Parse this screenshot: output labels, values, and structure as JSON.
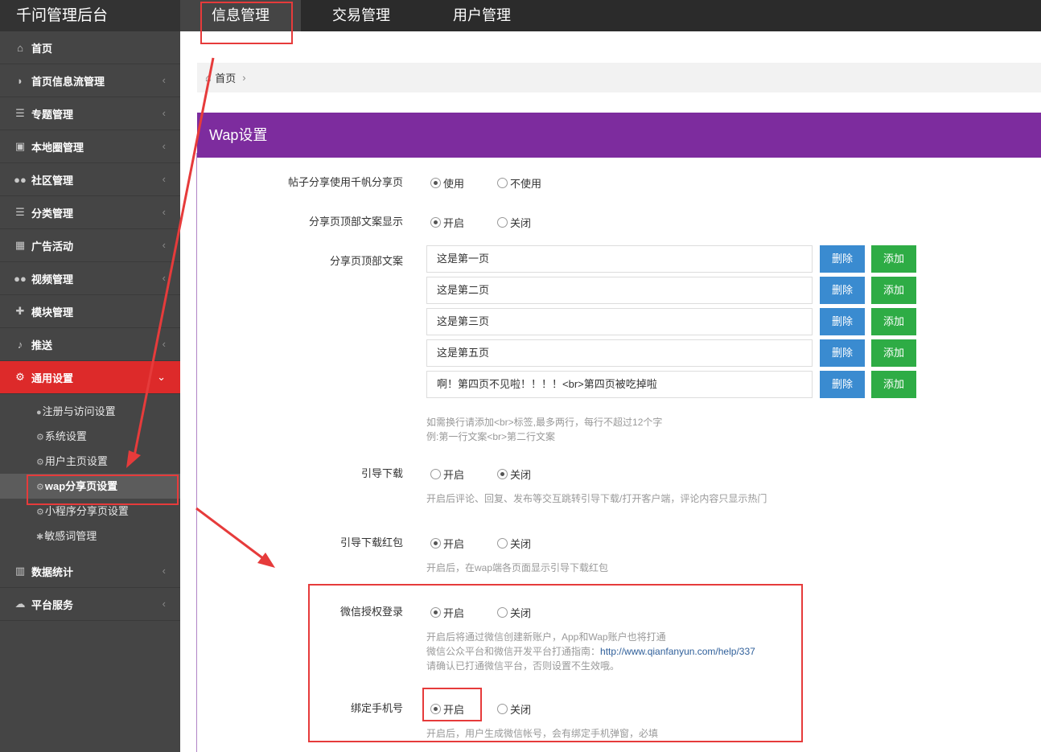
{
  "app": {
    "title": "千问管理后台"
  },
  "top_tabs": [
    {
      "label": "信息管理"
    },
    {
      "label": "交易管理"
    },
    {
      "label": "用户管理"
    }
  ],
  "sidebar": {
    "items": [
      {
        "label": "首页",
        "icon": "home-icon"
      },
      {
        "label": "首页信息流管理",
        "icon": "rss-icon"
      },
      {
        "label": "专题管理",
        "icon": "list-icon"
      },
      {
        "label": "本地圈管理",
        "icon": "camera-icon"
      },
      {
        "label": "社区管理",
        "icon": "users-icon"
      },
      {
        "label": "分类管理",
        "icon": "list-icon"
      },
      {
        "label": "广告活动",
        "icon": "calendar-icon"
      },
      {
        "label": "视频管理",
        "icon": "users-icon"
      },
      {
        "label": "模块管理",
        "icon": "puzzle-icon"
      },
      {
        "label": "推送",
        "icon": "bell-icon"
      },
      {
        "label": "通用设置",
        "icon": "gears-icon"
      }
    ],
    "sub_items": [
      {
        "label": "注册与访问设置",
        "icon": "user-icon"
      },
      {
        "label": "系统设置",
        "icon": "gears-icon"
      },
      {
        "label": "用户主页设置",
        "icon": "gears-icon"
      },
      {
        "label": "wap分享页设置",
        "icon": "gear-icon"
      },
      {
        "label": "小程序分享页设置",
        "icon": "gear-icon"
      },
      {
        "label": "敏感词管理",
        "icon": "asterisk-icon"
      }
    ],
    "bottom_items": [
      {
        "label": "数据统计",
        "icon": "bar-chart-icon"
      },
      {
        "label": "平台服务",
        "icon": "cloud-icon"
      }
    ]
  },
  "breadcrumb": {
    "home": "首页"
  },
  "panel": {
    "title": "Wap设置"
  },
  "settings": {
    "post_share": {
      "label": "帖子分享使用千帆分享页",
      "opt1": "使用",
      "opt2": "不使用"
    },
    "top_copy_show": {
      "label": "分享页顶部文案显示",
      "opt1": "开启",
      "opt2": "关闭"
    },
    "top_copy": {
      "label": "分享页顶部文案",
      "rows": [
        "这是第一页",
        "这是第二页",
        "这是第三页",
        "这是第五页",
        "啊！第四页不见啦！！！！<br>第四页被吃掉啦"
      ],
      "delete_label": "删除",
      "add_label": "添加",
      "hint1": "如需换行请添加<br>标签,最多两行，每行不超过12个字",
      "hint2": "例:第一行文案<br>第二行文案"
    },
    "guide_download": {
      "label": "引导下载",
      "opt1": "开启",
      "opt2": "关闭",
      "hint": "开启后评论、回复、发布等交互跳转引导下载/打开客户端，评论内容只显示热门"
    },
    "guide_redpack": {
      "label": "引导下载红包",
      "opt1": "开启",
      "opt2": "关闭",
      "hint": "开启后，在wap端各页面显示引导下载红包"
    },
    "wechat_login": {
      "label": "微信授权登录",
      "opt1": "开启",
      "opt2": "关闭",
      "hint1": "开启后将通过微信创建新账户，App和Wap账户也将打通",
      "hint2_prefix": "微信公众平台和微信开发平台打通指南：",
      "hint2_link": "http://www.qianfanyun.com/help/337",
      "hint3": "请确认已打通微信平台，否则设置不生效哦。"
    },
    "bind_phone": {
      "label": "绑定手机号",
      "opt1": "开启",
      "opt2": "关闭",
      "hint": "开启后，用户生成微信帐号，会有绑定手机弹窗，必填"
    }
  }
}
